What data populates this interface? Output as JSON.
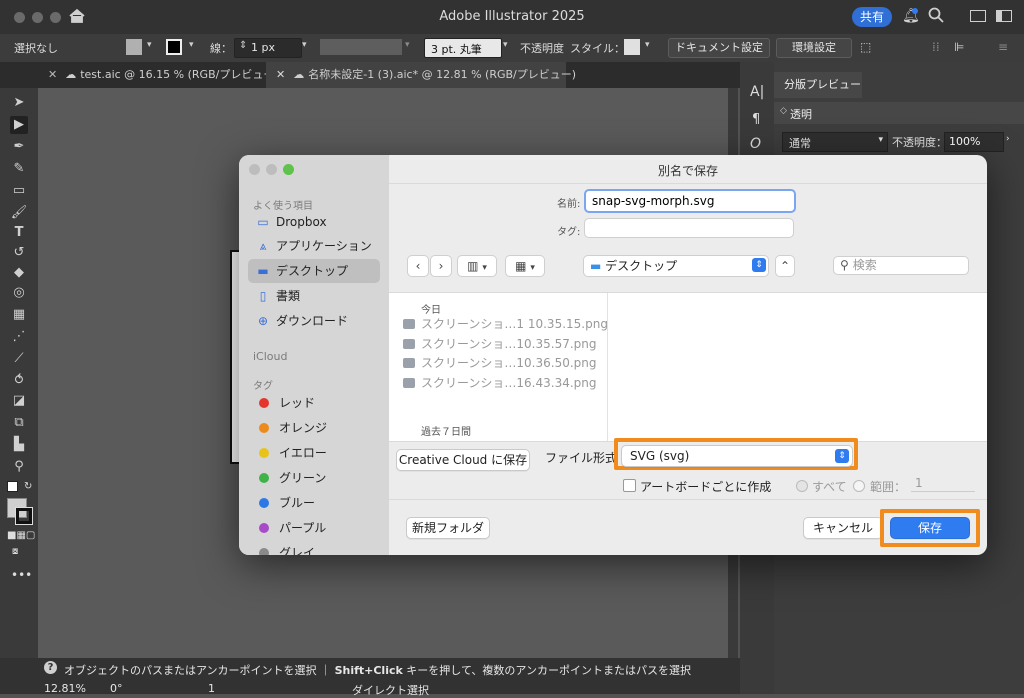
{
  "app": {
    "title": "Adobe Illustrator 2025",
    "share_label": "共有"
  },
  "control_bar": {
    "selection": "選択なし",
    "stroke_label": "線：",
    "stroke_width": "1 px",
    "brush": "3 pt. 丸筆",
    "opacity_label": "不透明度",
    "style_label": "スタイル：",
    "document_settings": "ドキュメント設定",
    "preferences": "環境設定"
  },
  "tabs": [
    {
      "label": "test.aic @ 16.15 % (RGB/プレビュー)"
    },
    {
      "label": "名称未設定-1 (3).aic* @ 12.81 % (RGB/プレビュー)"
    }
  ],
  "right_panel": {
    "separation_tab": "分版プレビュー",
    "transparency_tab": "透明",
    "blend_mode": "通常",
    "opacity_label": "不透明度：",
    "opacity_value": "100%"
  },
  "status_bar": {
    "hint_bold": "Shift+Click",
    "hint_pre": "オブジェクトのパスまたはアンカーポイントを選択 ｜",
    "hint_post": "キーを押して、複数のアンカーポイントまたはパスを選択",
    "zoom": "12.81%",
    "rotation": "0°",
    "artboard": "1",
    "tool": "ダイレクト選択"
  },
  "dialog": {
    "title": "別名で保存",
    "name_label": "名前:",
    "filename": "snap-svg-morph.svg",
    "tags_label": "タグ:",
    "location": "デスクトップ",
    "search_placeholder": "検索",
    "sidebar": {
      "favorites_heading": "よく使う項目",
      "favorites": [
        {
          "label": "Dropbox",
          "icon": "folder-icon"
        },
        {
          "label": "アプリケーション",
          "icon": "applications-icon"
        },
        {
          "label": "デスクトップ",
          "icon": "desktop-icon"
        },
        {
          "label": "書類",
          "icon": "document-icon"
        },
        {
          "label": "ダウンロード",
          "icon": "download-icon"
        }
      ],
      "icloud_heading": "iCloud",
      "tags_heading": "タグ",
      "tags": [
        {
          "label": "レッド",
          "color": "#e5362d"
        },
        {
          "label": "オレンジ",
          "color": "#ec8a1c"
        },
        {
          "label": "イエロー",
          "color": "#e8c41a"
        },
        {
          "label": "グリーン",
          "color": "#3fb34a"
        },
        {
          "label": "ブルー",
          "color": "#2d78e6"
        },
        {
          "label": "パープル",
          "color": "#a74bc8"
        },
        {
          "label": "グレイ",
          "color": "#8a8a8a"
        }
      ]
    },
    "today_heading": "今日",
    "files": [
      "スクリーンショ…1 10.35.15.png",
      "スクリーンショ…10.35.57.png",
      "スクリーンショ…10.36.50.png",
      "スクリーンショ…16.43.34.png"
    ],
    "past7_heading": "過去７日間",
    "cc_save": "Creative Cloud に保存",
    "format_label": "ファイル形式",
    "format_value": "SVG (svg)",
    "artboard_check": "アートボードごとに作成",
    "all_label": "すべて",
    "range_label": "範囲：",
    "range_value": "1",
    "new_folder": "新規フォルダ",
    "cancel": "キャンセル",
    "save": "保存"
  },
  "colors": {
    "highlight_orange": "#f08c1e",
    "primary_blue": "#2f7bf0"
  }
}
